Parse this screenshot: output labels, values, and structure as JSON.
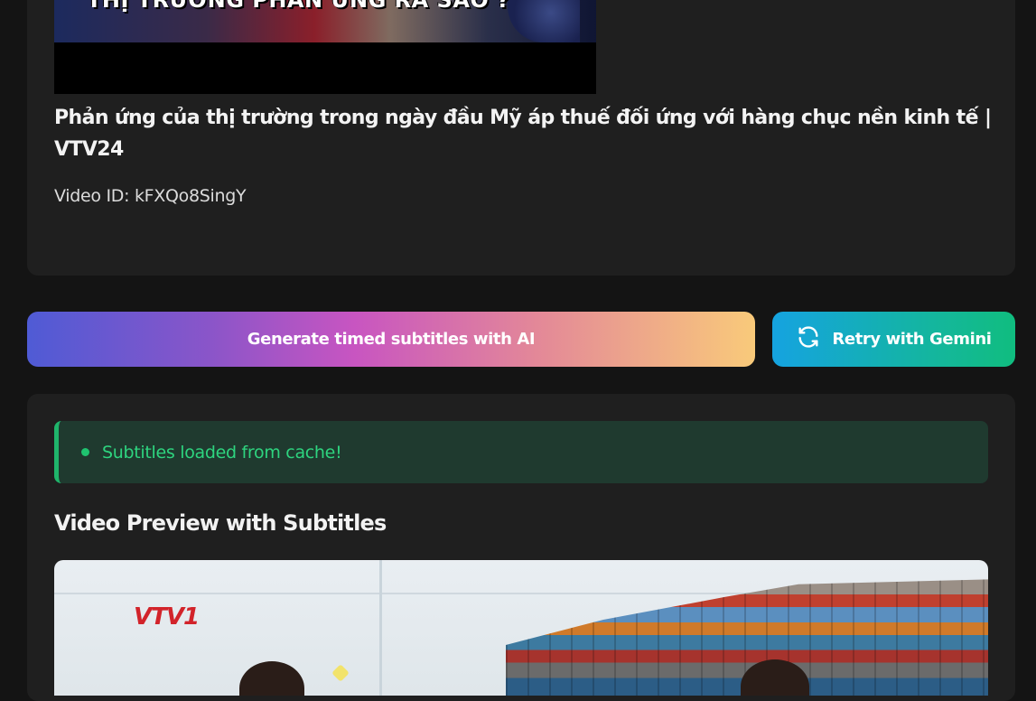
{
  "thumbnail": {
    "caption": "THỊ TRƯỜNG PHẢN ỨNG RA SAO ?"
  },
  "video": {
    "title": "Phản ứng của thị trường trong ngày đầu Mỹ áp thuế đối ứng với hàng chục nền kinh tế | VTV24",
    "id_label": "Video ID: kFXQo8SingY"
  },
  "actions": {
    "generate_label": "Generate timed subtitles with AI",
    "retry_label": "Retry with Gemini",
    "retry_icon": "refresh-icon"
  },
  "status": {
    "message": "Subtitles loaded from cache!",
    "color": "#2ed47f"
  },
  "preview": {
    "section_title": "Video Preview with Subtitles",
    "channel_logo": "VTV1"
  },
  "colors": {
    "background": "#141414",
    "card": "#1f1f1f",
    "success_bg": "#1f3a2f",
    "success_border": "#1fb56b"
  }
}
